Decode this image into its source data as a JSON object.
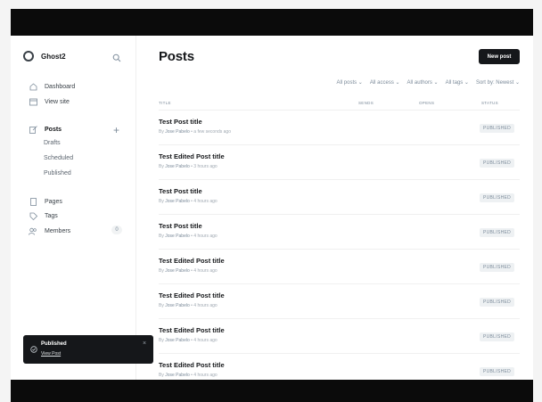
{
  "sidebar": {
    "site_name": "Ghost2",
    "nav": {
      "dashboard": "Dashboard",
      "view_site": "View site",
      "posts": "Posts",
      "drafts": "Drafts",
      "scheduled": "Scheduled",
      "published": "Published",
      "pages": "Pages",
      "tags": "Tags",
      "members": "Members",
      "members_count": "0"
    }
  },
  "header": {
    "title": "Posts",
    "new_post_label": "New post"
  },
  "filters": {
    "posts": "All posts ⌄",
    "access": "All access ⌄",
    "authors": "All authors ⌄",
    "tags": "All tags ⌄",
    "sort": "Sort by: Newest ⌄"
  },
  "table": {
    "headers": {
      "title": "TITLE",
      "sends": "SENDS",
      "opens": "OPENS",
      "status": "STATUS"
    },
    "rows": [
      {
        "title": "Test Post title",
        "author": "Jose Pabelo",
        "time": "• a few seconds ago",
        "by": "By",
        "status": "PUBLISHED"
      },
      {
        "title": "Test Edited Post title",
        "author": "Jose Pabelo",
        "time": "• 3 hours ago",
        "by": "By",
        "status": "PUBLISHED"
      },
      {
        "title": "Test Post title",
        "author": "Jose Pabelo",
        "time": "• 4 hours ago",
        "by": "By",
        "status": "PUBLISHED"
      },
      {
        "title": "Test Post title",
        "author": "Jose Pabelo",
        "time": "• 4 hours ago",
        "by": "By",
        "status": "PUBLISHED"
      },
      {
        "title": "Test Edited Post title",
        "author": "Jose Pabelo",
        "time": "• 4 hours ago",
        "by": "By",
        "status": "PUBLISHED"
      },
      {
        "title": "Test Edited Post title",
        "author": "Jose Pabelo",
        "time": "• 4 hours ago",
        "by": "By",
        "status": "PUBLISHED"
      },
      {
        "title": "Test Edited Post title",
        "author": "Jose Pabelo",
        "time": "• 4 hours ago",
        "by": "By",
        "status": "PUBLISHED"
      },
      {
        "title": "Test Edited Post title",
        "author": "Jose Pabelo",
        "time": "• 4 hours ago",
        "by": "By",
        "status": "PUBLISHED"
      }
    ]
  },
  "toast": {
    "title": "Published",
    "link": "View Post",
    "close": "×"
  }
}
